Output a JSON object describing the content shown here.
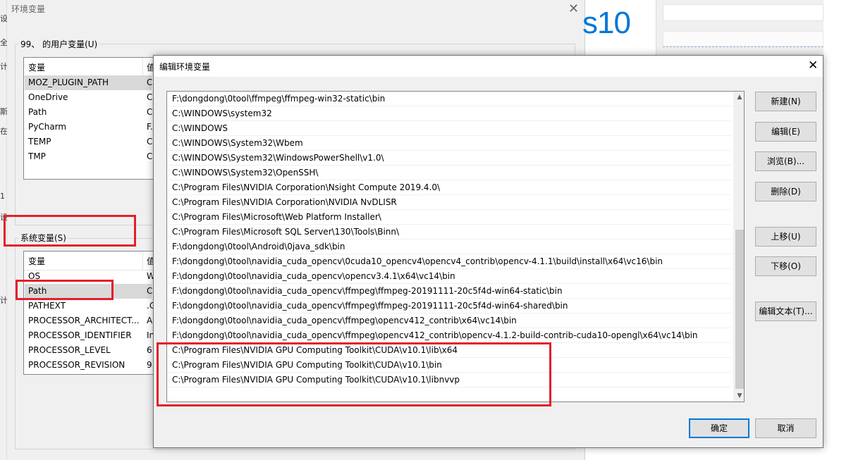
{
  "background": {
    "win10_text": "s10"
  },
  "left_edge_chars": [
    "设",
    "全",
    "计",
    "斯",
    "在",
    "1",
    "设",
    "计"
  ],
  "env_window": {
    "title": "环境变量",
    "close": "✕",
    "user_group_label": "99、 的用户变量(U)",
    "system_group_label": "系统变量(S)",
    "col_variable": "变量",
    "col_value": "值",
    "user_vars": [
      {
        "name": "MOZ_PLUGIN_PATH",
        "value": "C"
      },
      {
        "name": "OneDrive",
        "value": "C"
      },
      {
        "name": "Path",
        "value": "C"
      },
      {
        "name": "PyCharm",
        "value": "F."
      },
      {
        "name": "TEMP",
        "value": "C"
      },
      {
        "name": "TMP",
        "value": "C"
      }
    ],
    "system_vars": [
      {
        "name": "OS",
        "value": "W"
      },
      {
        "name": "Path",
        "value": "C"
      },
      {
        "name": "PATHEXT",
        "value": ".C"
      },
      {
        "name": "PROCESSOR_ARCHITECT...",
        "value": "A"
      },
      {
        "name": "PROCESSOR_IDENTIFIER",
        "value": "In"
      },
      {
        "name": "PROCESSOR_LEVEL",
        "value": "6"
      },
      {
        "name": "PROCESSOR_REVISION",
        "value": "9"
      }
    ]
  },
  "edit_dialog": {
    "title": "编辑环境变量",
    "close": "✕",
    "paths": [
      "F:\\dongdong\\0tool\\ffmpeg\\ffmpeg-win32-static\\bin",
      "C:\\WINDOWS\\system32",
      "C:\\WINDOWS",
      "C:\\WINDOWS\\System32\\Wbem",
      "C:\\WINDOWS\\System32\\WindowsPowerShell\\v1.0\\",
      "C:\\WINDOWS\\System32\\OpenSSH\\",
      "C:\\Program Files\\NVIDIA Corporation\\Nsight Compute 2019.4.0\\",
      "C:\\Program Files\\NVIDIA Corporation\\NVIDIA NvDLISR",
      "C:\\Program Files\\Microsoft\\Web Platform Installer\\",
      "C:\\Program Files\\Microsoft SQL Server\\130\\Tools\\Binn\\",
      "F:\\dongdong\\0tool\\Android\\0java_sdk\\bin",
      "F:\\dongdong\\0tool\\navidia_cuda_opencv\\0cuda10_opencv4\\opencv4_contrib\\opencv-4.1.1\\build\\install\\x64\\vc16\\bin",
      "F:\\dongdong\\0tool\\navidia_cuda_opencv\\opencv3.4.1\\x64\\vc14\\bin",
      "F:\\dongdong\\0tool\\navidia_cuda_opencv\\ffmpeg\\ffmpeg-20191111-20c5f4d-win64-static\\bin",
      "F:\\dongdong\\0tool\\navidia_cuda_opencv\\ffmpeg\\ffmpeg-20191111-20c5f4d-win64-shared\\bin",
      "F:\\dongdong\\0tool\\navidia_cuda_opencv\\ffmpeg\\opencv412_contrib\\x64\\vc14\\bin",
      "F:\\dongdong\\0tool\\navidia_cuda_opencv\\ffmpeg\\opencv412_contrib\\opencv-4.1.2-build-contrib-cuda10-opengl\\x64\\vc14\\bin",
      "C:\\Program Files\\NVIDIA GPU Computing Toolkit\\CUDA\\v10.1\\lib\\x64",
      "C:\\Program Files\\NVIDIA GPU Computing Toolkit\\CUDA\\v10.1\\bin",
      "C:\\Program Files\\NVIDIA GPU Computing Toolkit\\CUDA\\v10.1\\libnvvp"
    ],
    "buttons": {
      "new": "新建(N)",
      "edit": "编辑(E)",
      "browse": "浏览(B)...",
      "delete": "删除(D)",
      "move_up": "上移(U)",
      "move_down": "下移(O)",
      "edit_text": "编辑文本(T)...",
      "ok": "确定",
      "cancel": "取消"
    },
    "scroll_up": "▲",
    "scroll_down": "▼"
  },
  "colors": {
    "highlight_red": "#e3202b",
    "accent_blue": "#0078d7"
  }
}
